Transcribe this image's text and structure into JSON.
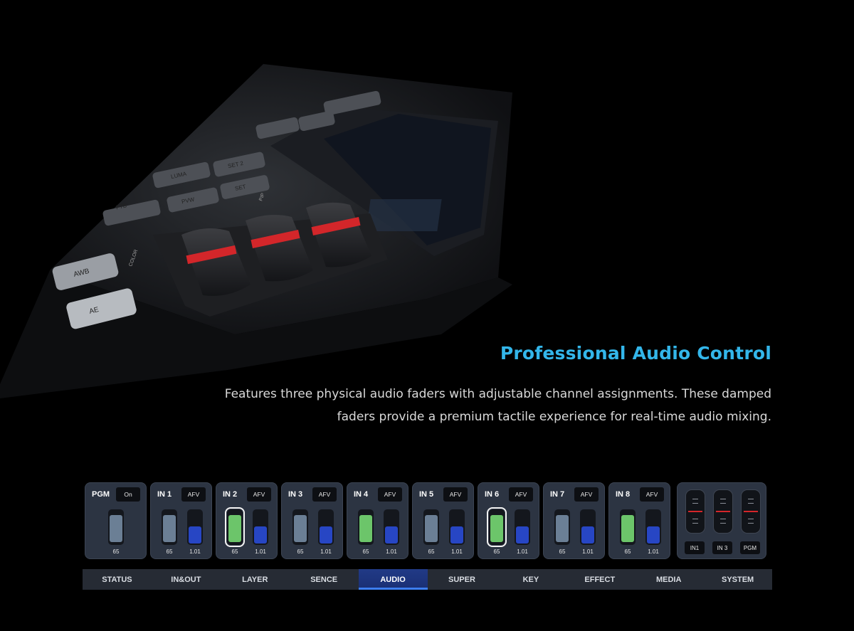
{
  "feature": {
    "heading": "Professional Audio Control",
    "body_line_1": "Features three physical audio faders with adjustable channel assignments. These damped",
    "body_line_2": "faders provide a premium tactile experience for real-time audio mixing."
  },
  "hardware_labels": {
    "awb": "AWB",
    "ae": "AE",
    "color": "COLOR",
    "pip": "PIP",
    "key_1": "FTB",
    "key_2": "PVW",
    "key_3": "SET",
    "key_4": "LUMA",
    "key_5": "SET 2"
  },
  "colors": {
    "accent": "#33b6ea",
    "fader_active": "#6cc56a",
    "fader_inactive": "#6b7f95",
    "volume": "#2746c4",
    "tab_active": "#1f3a86",
    "strip_bg": "#2c3442"
  },
  "mixer": {
    "pgm": {
      "name": "PGM",
      "button": "On",
      "fader_value": "65"
    },
    "channels": [
      {
        "name": "IN 1",
        "button": "AFV",
        "fader_value": "65",
        "volume_value": "1.01",
        "active": false,
        "selected": false
      },
      {
        "name": "IN 2",
        "button": "AFV",
        "fader_value": "65",
        "volume_value": "1.01",
        "active": true,
        "selected": true
      },
      {
        "name": "IN 3",
        "button": "AFV",
        "fader_value": "65",
        "volume_value": "1.01",
        "active": false,
        "selected": false
      },
      {
        "name": "IN 4",
        "button": "AFV",
        "fader_value": "65",
        "volume_value": "1.01",
        "active": true,
        "selected": false
      },
      {
        "name": "IN 5",
        "button": "AFV",
        "fader_value": "65",
        "volume_value": "1.01",
        "active": false,
        "selected": false
      },
      {
        "name": "IN 6",
        "button": "AFV",
        "fader_value": "65",
        "volume_value": "1.01",
        "active": true,
        "selected": true
      },
      {
        "name": "IN 7",
        "button": "AFV",
        "fader_value": "65",
        "volume_value": "1.01",
        "active": false,
        "selected": false
      },
      {
        "name": "IN 8",
        "button": "AFV",
        "fader_value": "65",
        "volume_value": "1.01",
        "active": true,
        "selected": false
      }
    ],
    "fader_assign": [
      "IN1",
      "IN 3",
      "PGM"
    ]
  },
  "tabs": [
    {
      "label": "STATUS",
      "active": false
    },
    {
      "label": "IN&OUT",
      "active": false
    },
    {
      "label": "LAYER",
      "active": false
    },
    {
      "label": "SENCE",
      "active": false
    },
    {
      "label": "AUDIO",
      "active": true
    },
    {
      "label": "SUPER",
      "active": false
    },
    {
      "label": "KEY",
      "active": false
    },
    {
      "label": "EFFECT",
      "active": false
    },
    {
      "label": "MEDIA",
      "active": false
    },
    {
      "label": "SYSTEM",
      "active": false
    }
  ]
}
